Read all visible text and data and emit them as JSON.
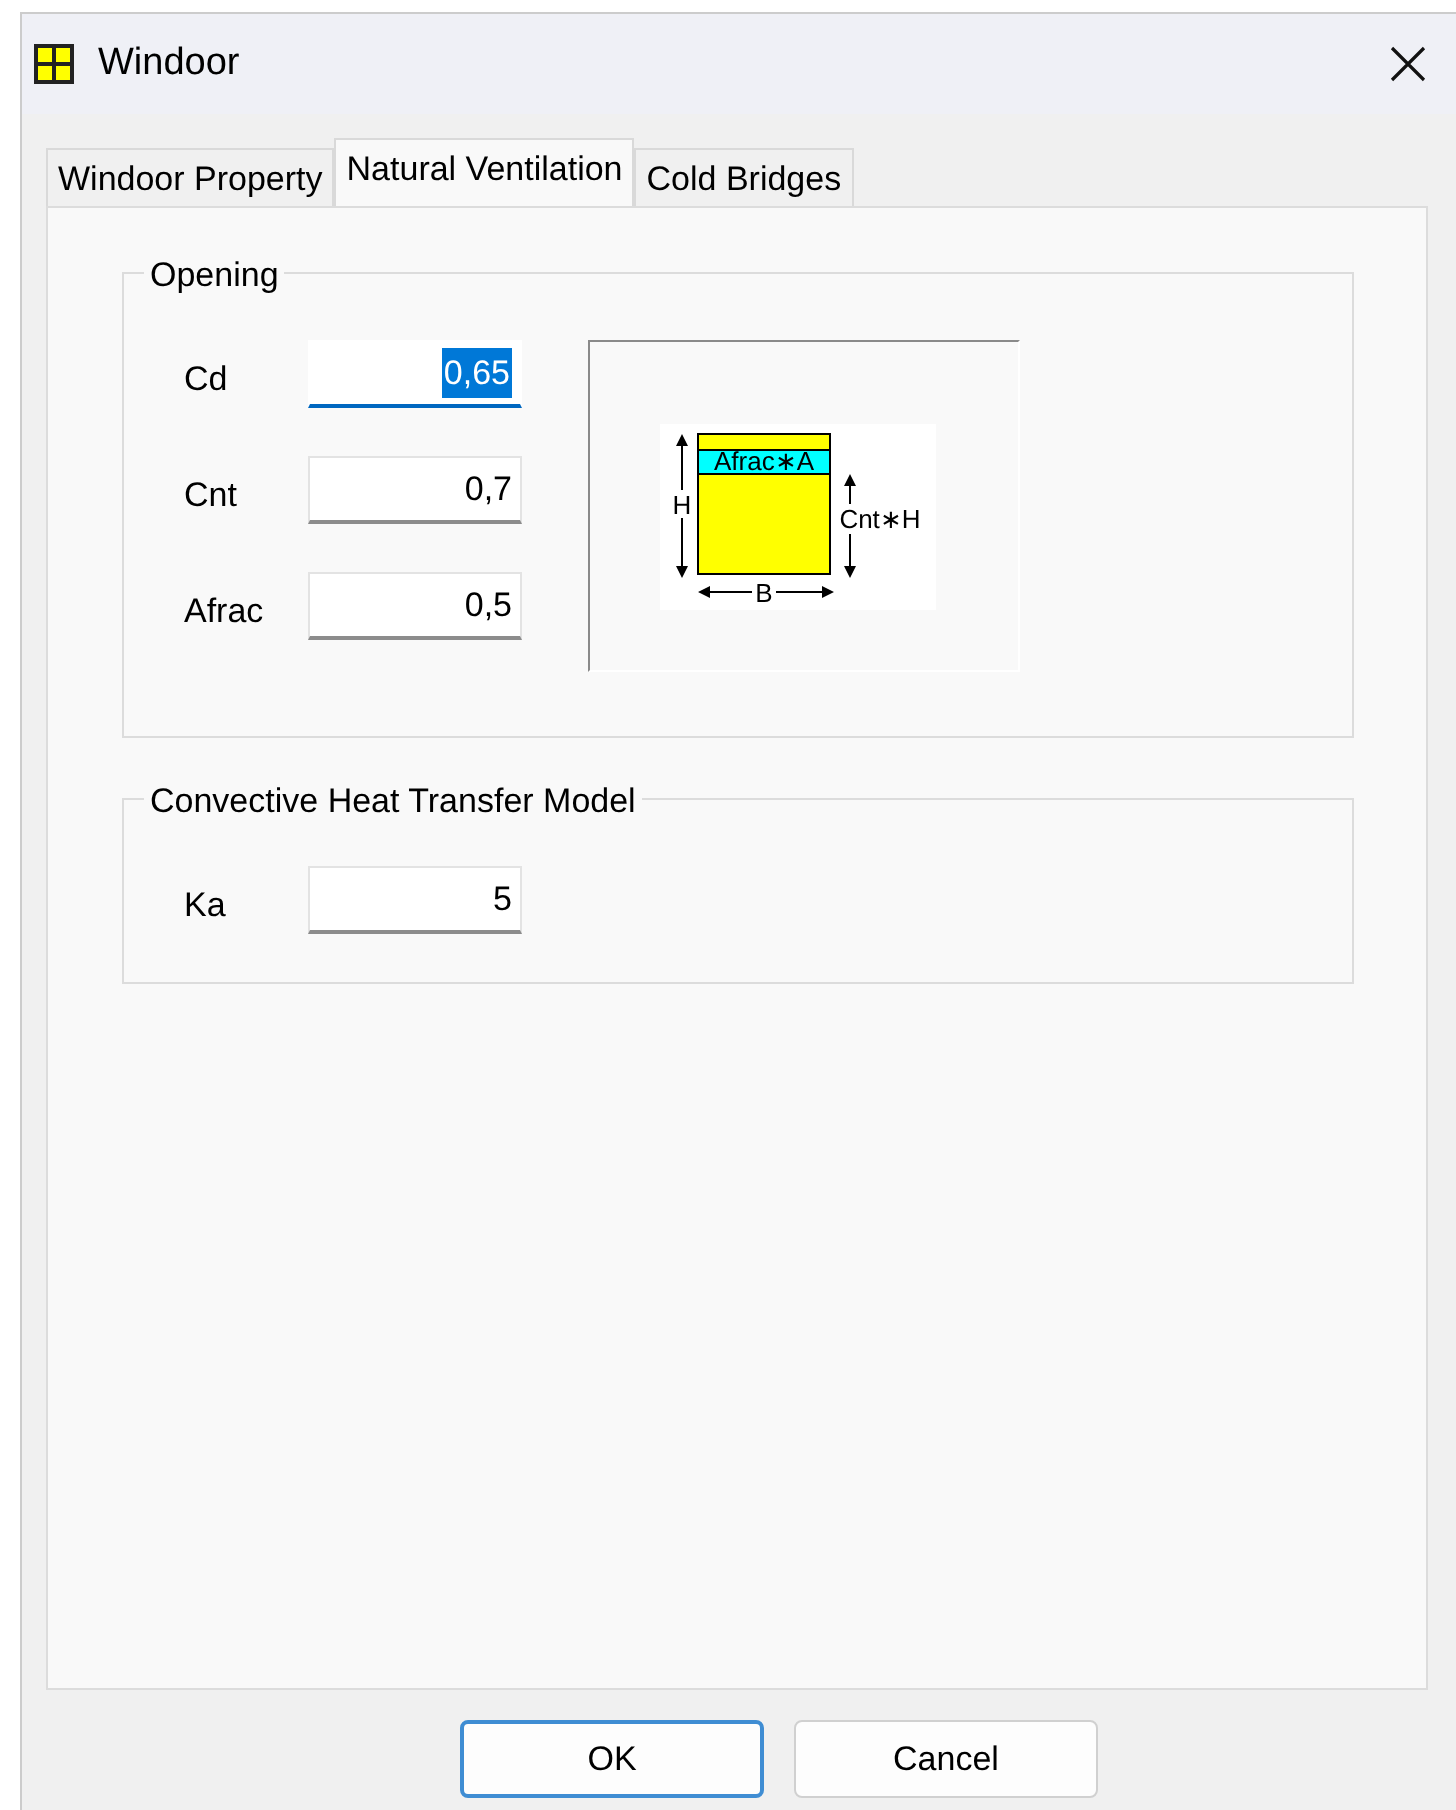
{
  "window": {
    "title": "Windoor"
  },
  "tabs": [
    {
      "label": "Windoor Property",
      "selected": false
    },
    {
      "label": "Natural Ventilation",
      "selected": true
    },
    {
      "label": "Cold Bridges",
      "selected": false
    }
  ],
  "groups": [
    {
      "title": "Opening",
      "fields": [
        {
          "label": "Cd",
          "value": "0,65",
          "focused": true
        },
        {
          "label": "Cnt",
          "value": "0,7",
          "focused": false
        },
        {
          "label": "Afrac",
          "value": "0,5",
          "focused": false
        }
      ],
      "diagram": {
        "area_label": "Afrac∗A",
        "height_label": "H",
        "opening_label": "Cnt∗H",
        "width_label": "B"
      }
    },
    {
      "title": "Convective Heat Transfer Model",
      "fields": [
        {
          "label": "Ka",
          "value": "5",
          "focused": false
        }
      ]
    }
  ],
  "buttons": [
    {
      "label": "OK",
      "default": true
    },
    {
      "label": "Cancel",
      "default": false
    }
  ]
}
